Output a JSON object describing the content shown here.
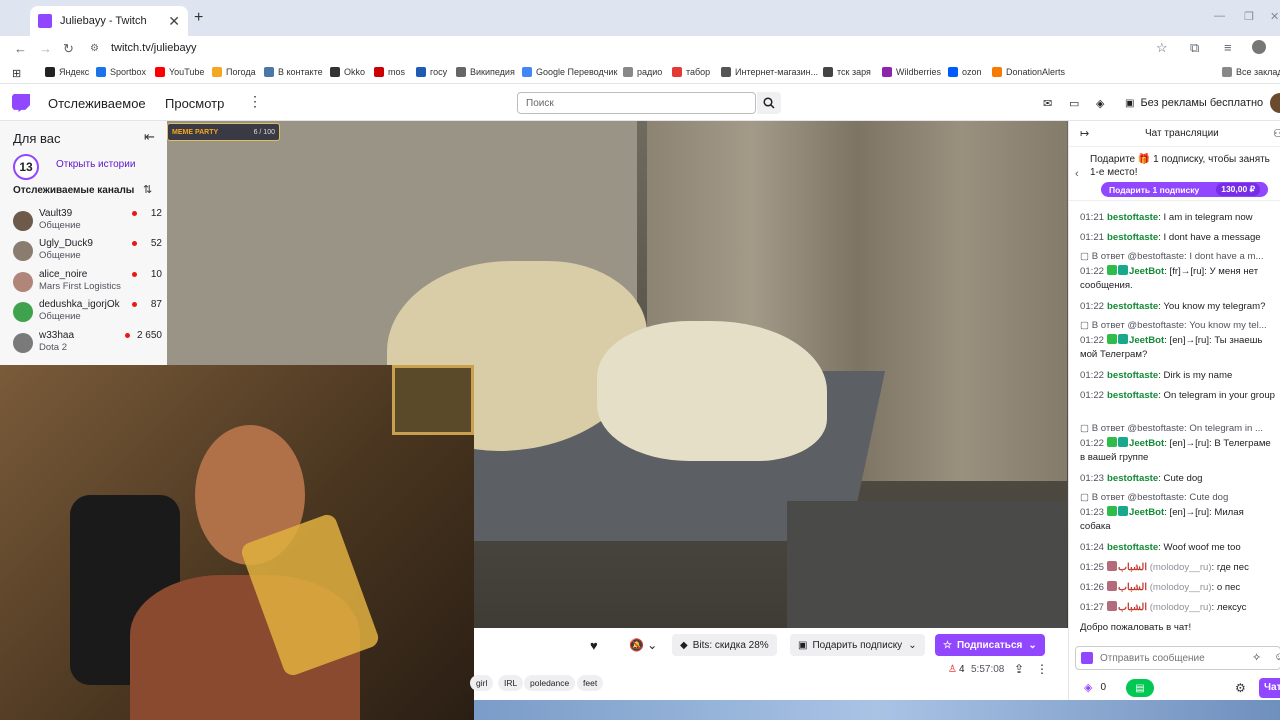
{
  "browser": {
    "tab_title": "Juliebayy - Twitch",
    "tab_close": "✕",
    "new_tab": "+",
    "url": "twitch.tv/juliebayy",
    "bookmarks": [
      {
        "label": "Яндекс",
        "color": "#222222"
      },
      {
        "label": "Sportbox",
        "color": "#1a73e8"
      },
      {
        "label": "YouTube",
        "color": "#ff0000"
      },
      {
        "label": "Погода",
        "color": "#f5a623"
      },
      {
        "label": "В контакте",
        "color": "#4a76a8"
      },
      {
        "label": "Okko",
        "color": "#333333"
      },
      {
        "label": "mos",
        "color": "#cc0000"
      },
      {
        "label": "госу",
        "color": "#1f5bb5"
      },
      {
        "label": "Википедия",
        "color": "#666666"
      },
      {
        "label": "Google Переводчик",
        "color": "#4285f4"
      },
      {
        "label": "радио",
        "color": "#888888"
      },
      {
        "label": "табор",
        "color": "#e53935"
      },
      {
        "label": "Интернет-магазин...",
        "color": "#555555"
      },
      {
        "label": "тск заря",
        "color": "#444444"
      },
      {
        "label": "Wildberries",
        "color": "#8e24aa"
      },
      {
        "label": "ozon",
        "color": "#005bff"
      },
      {
        "label": "DonationAlerts",
        "color": "#f57c00"
      }
    ],
    "all_bookmarks": "Все заклад"
  },
  "twitch_nav": {
    "following": "Отслеживаемое",
    "browse": "Просмотр",
    "more": "⋮",
    "search_placeholder": "Поиск",
    "no_ads": "Без рекламы бесплатно"
  },
  "sidebar": {
    "for_you": "Для вас",
    "collapse": "⇤",
    "stories_icon_text": "13",
    "open_stories": "Открыть истории",
    "followed_channels": "Отслеживаемые каналы",
    "sort": "⇅",
    "channels": [
      {
        "name": "Vault39",
        "game": "Общение",
        "viewers": "12",
        "avatar": "#6d5a4a"
      },
      {
        "name": "Ugly_Duck9",
        "game": "Общение",
        "viewers": "52",
        "avatar": "#8a7d70"
      },
      {
        "name": "alice_noire",
        "game": "Mars First Logistics",
        "viewers": "10",
        "avatar": "#b0857a"
      },
      {
        "name": "dedushka_igorjOk",
        "game": "Общение",
        "viewers": "87",
        "avatar": "#3fa34d"
      },
      {
        "name": "w33haa",
        "game": "Dota 2",
        "viewers": "2 650",
        "avatar": "#7a7a7a"
      }
    ]
  },
  "video_overlay": {
    "party": "MEME PARTY",
    "counter": "6 / 100"
  },
  "player_bar": {
    "heart": "♥",
    "notifications": "🔕 ⌄",
    "bits": "Bits: скидка 28%",
    "gift_sub": "Подарить подписку",
    "subscribe": "Подписаться",
    "tags": [
      "girl",
      "IRL",
      "poledance",
      "feet"
    ],
    "viewers": "4",
    "uptime": "5:57:08",
    "share": "⇪",
    "more": "⋮"
  },
  "chat": {
    "title": "Чат трансляции",
    "promo_text": "Подарите 🎁 1 подписку, чтобы занять 1-е место!",
    "promo_button": "Подарить 1 подписку",
    "promo_price": "130,00 ₽",
    "messages": [
      {
        "kind": "msg",
        "time": "01:21",
        "user": "bestoftaste",
        "ucolor": "green",
        "text": "I am in telegram now"
      },
      {
        "kind": "msg",
        "time": "01:21",
        "user": "bestoftaste",
        "ucolor": "green",
        "text": "I dont have a message"
      },
      {
        "kind": "reply",
        "text": "В ответ @bestoftaste: I dont have a m..."
      },
      {
        "kind": "bot",
        "time": "01:22",
        "user": "JeetBot",
        "text": "[fr]→[ru]: У меня нет сообщения."
      },
      {
        "kind": "msg",
        "time": "01:22",
        "user": "bestoftaste",
        "ucolor": "green",
        "text": "You know my telegram?"
      },
      {
        "kind": "reply",
        "text": "В ответ @bestoftaste: You know my tel..."
      },
      {
        "kind": "bot",
        "time": "01:22",
        "user": "JeetBot",
        "text": "[en]→[ru]: Ты знаешь мой Телеграм?"
      },
      {
        "kind": "msg",
        "time": "01:22",
        "user": "bestoftaste",
        "ucolor": "green",
        "text": "Dirk is my name"
      },
      {
        "kind": "msg",
        "time": "01:22",
        "user": "bestoftaste",
        "ucolor": "green",
        "text": "On telegram in your group"
      },
      {
        "kind": "reply",
        "text": "В ответ @bestoftaste: On telegram in ..."
      },
      {
        "kind": "bot",
        "time": "01:22",
        "user": "JeetBot",
        "text": "[en]→[ru]: В Телеграме в вашей группе"
      },
      {
        "kind": "msg",
        "time": "01:23",
        "user": "bestoftaste",
        "ucolor": "green",
        "text": "Cute dog"
      },
      {
        "kind": "reply",
        "text": "В ответ @bestoftaste: Cute dog"
      },
      {
        "kind": "bot",
        "time": "01:23",
        "user": "JeetBot",
        "text": "[en]→[ru]: Милая собака"
      },
      {
        "kind": "msg",
        "time": "01:24",
        "user": "bestoftaste",
        "ucolor": "green",
        "text": "Woof woof me too"
      },
      {
        "kind": "ar",
        "time": "01:25",
        "user": "الشباب",
        "sub": "(molodoy__ru)",
        "text": "где пес"
      },
      {
        "kind": "ar",
        "time": "01:26",
        "user": "الشباب",
        "sub": "(molodoy__ru)",
        "text": "о пес"
      },
      {
        "kind": "ar",
        "time": "01:27",
        "user": "الشباب",
        "sub": "(molodoy__ru)",
        "text": "лексус"
      },
      {
        "kind": "system",
        "text": "Добро пожаловать в чат!"
      }
    ],
    "input_placeholder": "Отправить сообщение",
    "points": "0",
    "chat_button": "Чат"
  },
  "colors": {
    "twitch_purple": "#9146ff",
    "username_green": "#138a36",
    "live_red": "#e91916"
  }
}
